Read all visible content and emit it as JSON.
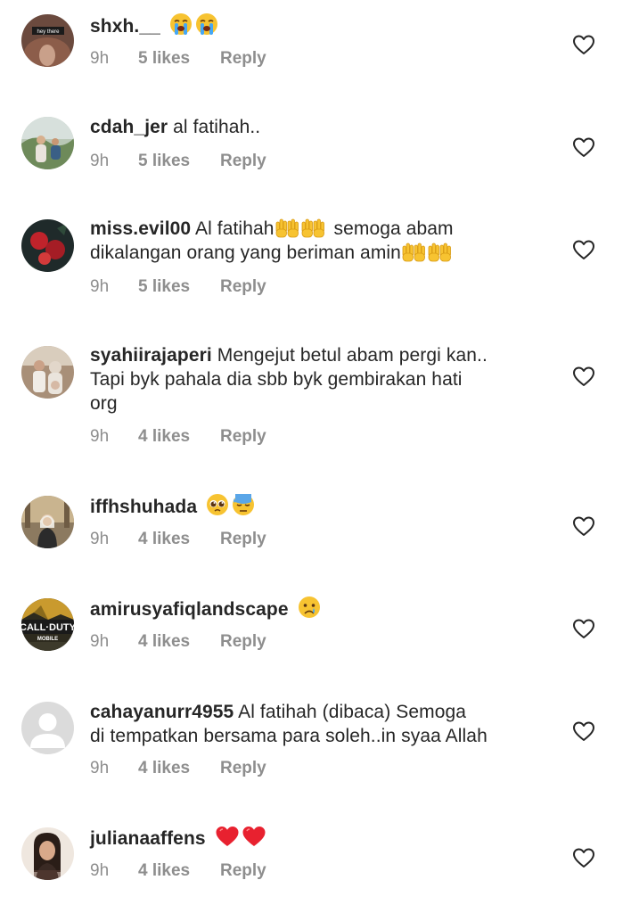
{
  "comments": [
    {
      "username": "shxh.__",
      "text": "",
      "emojis": [
        "loudly-crying-face",
        "loudly-crying-face"
      ],
      "avatar_caption": "hey there",
      "time": "9h",
      "likes": "5 likes",
      "reply": "Reply"
    },
    {
      "username": "cdah_jer",
      "text": "al fatihah..",
      "emojis": [],
      "time": "9h",
      "likes": "5 likes",
      "reply": "Reply"
    },
    {
      "username": "miss.evil00",
      "text_line1": "Al fatihah",
      "text_line1b": "semoga abam",
      "text_line2": "dikalangan orang yang beriman amin",
      "emojis": [
        "raised-hands",
        "raised-hands"
      ],
      "time": "9h",
      "likes": "5 likes",
      "reply": "Reply"
    },
    {
      "username": "syahiirajaperi",
      "text": "Mengejut betul abam pergi kan.. Tapi byk pahala dia sbb byk gembirakan hati org",
      "text_line1": "Mengejut betul abam pergi kan..",
      "text_line2": "Tapi byk pahala dia sbb byk gembirakan hati",
      "text_line3": "org",
      "emojis": [],
      "time": "9h",
      "likes": "4 likes",
      "reply": "Reply"
    },
    {
      "username": "iffhshuhada",
      "text": "",
      "emojis": [
        "pleading-face",
        "downcast-face-with-sweat"
      ],
      "time": "9h",
      "likes": "4 likes",
      "reply": "Reply"
    },
    {
      "username": "amirusyafiqlandscape",
      "text": "",
      "emojis": [
        "crying-face"
      ],
      "avatar_caption_1": "CALL·DUTY",
      "avatar_caption_2": "MOBILE",
      "time": "9h",
      "likes": "4 likes",
      "reply": "Reply"
    },
    {
      "username": "cahayanurr4955",
      "text": "Al fatihah (dibaca) Semoga di tempatkan bersama para soleh..in syaa Allah",
      "text_line1": "Al fatihah (dibaca) Semoga",
      "text_line2": "di tempatkan bersama para soleh..in syaa Allah",
      "emojis": [],
      "time": "9h",
      "likes": "4 likes",
      "reply": "Reply"
    },
    {
      "username": "julianaaffens",
      "text": "",
      "emojis": [
        "red-heart",
        "red-heart"
      ],
      "time": "9h",
      "likes": "4 likes",
      "reply": "Reply"
    }
  ],
  "colors": {
    "text": "#262626",
    "meta": "#8e8e8e",
    "heart_outline": "#262626",
    "background": "#ffffff"
  },
  "icons": {
    "like": "heart-outline-icon"
  }
}
